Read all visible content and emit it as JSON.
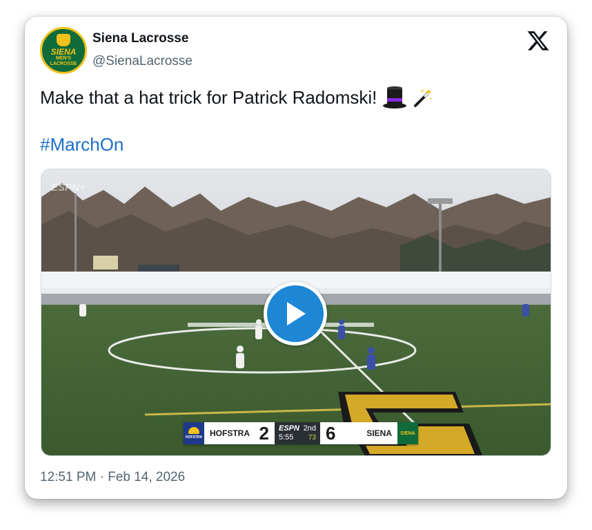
{
  "account": {
    "display_name": "Siena Lacrosse",
    "handle": "@SienaLacrosse",
    "avatar_text": [
      "SIENA",
      "MEN'S",
      "LACROSSE"
    ]
  },
  "platform_icon": "x-logo-icon",
  "tweet": {
    "text": "Make that a hat trick for Patrick Radomski!",
    "emojis": [
      "top-hat-icon",
      "magic-wand-icon"
    ],
    "hashtag": "#MarchOn",
    "timestamp": "12:51 PM · Feb 14, 2026"
  },
  "video": {
    "play_icon": "play-icon",
    "watermark": "ESPN+",
    "scorebug": {
      "home_team": "HOFSTRA",
      "home_logo_text": "HOFSTRA",
      "home_score": "2",
      "network": "ESPN",
      "period": "2nd",
      "clock": "5:55",
      "shot_clock": "73",
      "away_score": "6",
      "away_team": "SIENA",
      "away_logo_text": "SIENA"
    }
  },
  "colors": {
    "hashtag": "#1d6ec8",
    "play_button": "#1d87d6",
    "siena_green": "#0f6b3a",
    "siena_gold": "#f2c21b",
    "hofstra_blue": "#1f3a8a"
  }
}
